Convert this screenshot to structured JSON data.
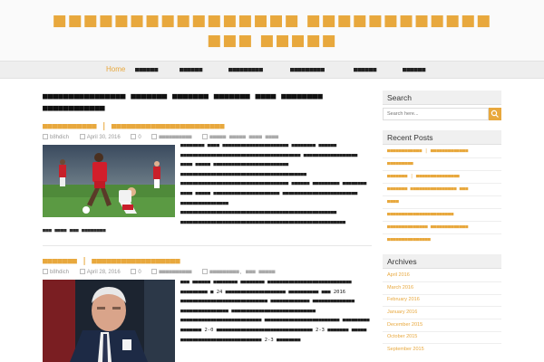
{
  "header": {
    "title": "■■■■■■■■■■■■■■■■ ■■■■■■■■■■■■ ■■■ ■■■■■"
  },
  "nav": {
    "items": [
      {
        "label": "Home",
        "active": true
      },
      {
        "label": "■■■■■■"
      },
      {
        "label": "■■■■■■"
      },
      {
        "label": "■■■■■■■■■"
      },
      {
        "label": "■■■■■■■■■"
      },
      {
        "label": "■■■■■■"
      },
      {
        "label": "■■■■■■"
      }
    ]
  },
  "main": {
    "heading": "■■■■■■■■■■■■■■■■ ■■■■■■■ ■■■■■■■ ■■■■■■■ ■■■■ ■■■■■■■■ ■■■■■■■■■■■■",
    "posts": [
      {
        "title": "■■■■■■■■■■■ | ■■■■■■■■■■■■■■■■■■■■■■■",
        "author": "b8hdich",
        "date": "April 30, 2016",
        "comments": "0",
        "category": "■■■■■■■■■■",
        "tags": "■■■■■ ■■■■■ ■■■■ ■■■■",
        "excerpt": "■■■■■■■■ ■■■■ ■■■■■■■■■■■■■■■■■■■■■■ ■■■■■■■■ ■■■■■■ ■■■■■■■■■■■■■■■■■■■■■■■■■■■■■■■■■■■■■■■■ ■■■■■■■■■■■■■■■■■■ ■■■■ ■■■■■ ■■■■■■■■■■■■■■■■■■■■■■■■■ ■■■■■■■■■■■■■■■■■■■■■■■■■■■■■■■■■■■■■■■■■■ ■■■■■■■■■■■■■■■■■■■■■■■■■■■■■■■■■■■■ ■■■■■■ ■■■■■■■■■ ■■■■■■■■ ■■■■ ■■■■■ ■■■■■■■■■■■■■■■■■■■■■■ ■■■■■■■■■■■■■■■■■■■■■■■■■ ■■■■■■■■■■■■■■■■ ■■■■■■■■■■■■■■■■■■■■■■■■■■■■■■■■■■■■■■■■■■■■■■■■■■■■ ■■■■■■■■■■■■■■■■■■■■■■■■■■■■■■■■■■■■■■■■■■■■■■■■■■■■■■■",
        "more": "■■■ ■■■■ ■■■ ■■■■■■■■"
      },
      {
        "title": "■■■■■■■ | ■■■■■■■■■■■■■■■■■■",
        "author": "b8hdich",
        "date": "April 28, 2016",
        "comments": "0",
        "category": "■■■■■■■■■■",
        "tags": "■■■■■■■■■, ■■■ ■■■■■",
        "excerpt": "■■■ ■■■■■■ ■■■■■■■■ ■■■■■■■■ ■■■■■■■■■■■■■■■■■■■■■■■■■■■■ ■■■■■■■■■ ■ 24 ■■■■■■■■■■■■■■■■■■■■ ■■■■■■■■■■ ■■■ 2016 ■■■■■■■■■■■■■■■■■■■■■■■■■■■■■ ■■■■■■■■■■■■■ ■■■■■■■■■■■■■■ ■■■■■■■■■■■■■■■■ ■■■■■■■■■■■■■■■■■■■■■■■■■■■■ ■■■■■■■■■■■■■■■■■■■■■■■■■■■ ■■■■■■■■■■■■■■■■■■■■■■■■■ ■■■■■■■■■ ■■■■■■■ 2-0 ■■■■■■■■■■■■■■■■■■■■■■■■■■■■■■■■ 2-3 ■■■■■■■ ■■■■■ ■■■■■■■■■■■■■■■■■■■■■■■■■■■ 2-3 ■■■■■■■■"
      }
    ]
  },
  "sidebar": {
    "search_title": "Search",
    "search_placeholder": "Search here...",
    "recent_title": "Recent Posts",
    "recent": [
      "■■■■■■■■■■■■ | ■■■■■■■■■■■■■",
      "■■■■■■■■■",
      "■■■■■■■ | ■■■■■■■■■■■■■■■",
      "■■■■■■■ ■■■■■■■■■■■■■■■■ ■■■",
      "■■■■",
      "■■■■■■■■■■■■■■■■■■■■■■■",
      "■■■■■■■■■■■■■■ ■■■■■■■■■■■■■",
      "■■■■■■■■■■■■■■■"
    ],
    "archives_title": "Archives",
    "archives": [
      "April 2016",
      "March 2016",
      "February 2016",
      "January 2016",
      "December 2015",
      "October 2015",
      "September 2015"
    ]
  },
  "colors": {
    "accent": "#e8a83d",
    "nav_bg": "#eeeeee",
    "header_bg": "#fafafa"
  },
  "icons": [
    "user-icon",
    "calendar-icon",
    "comment-icon",
    "folder-icon",
    "tag-icon",
    "search-icon"
  ]
}
